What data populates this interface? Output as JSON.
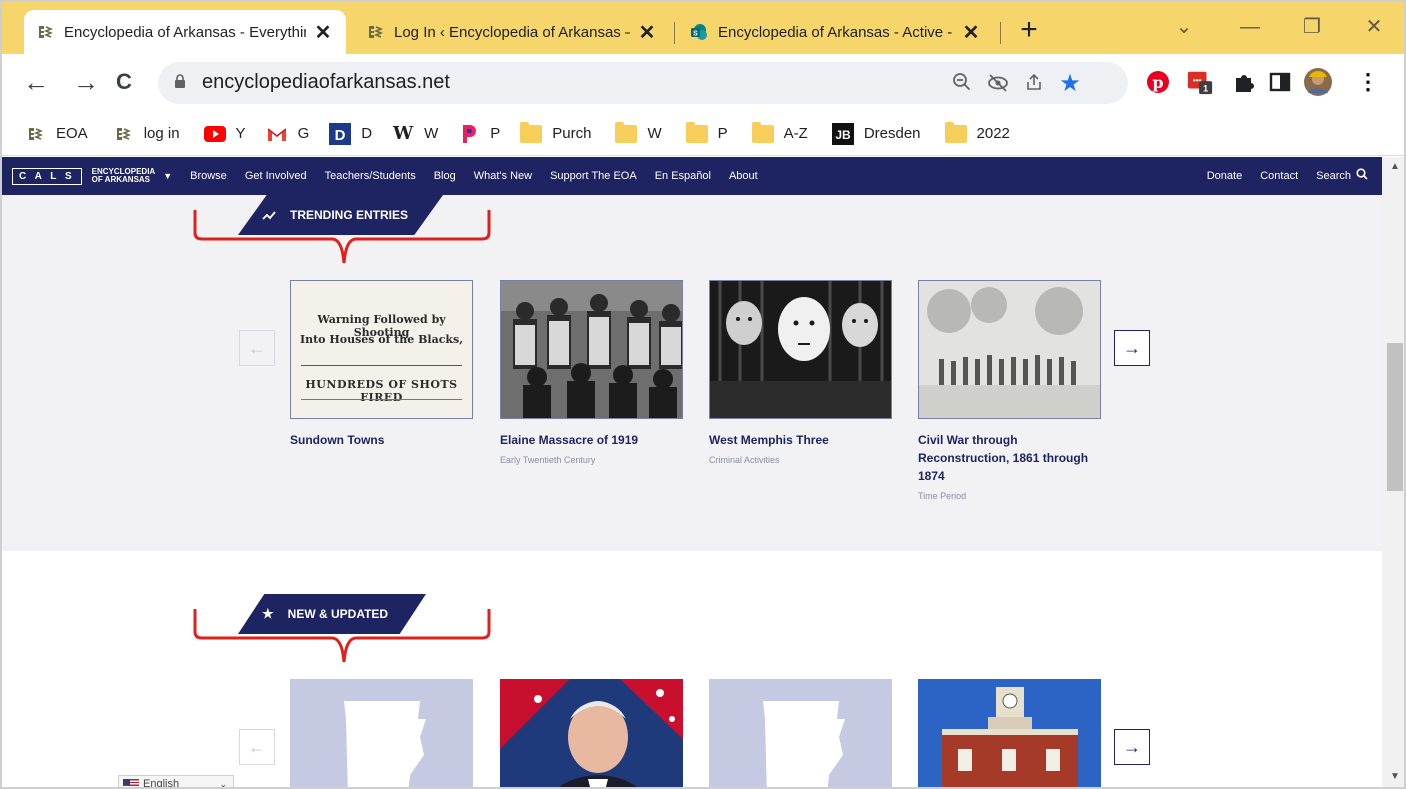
{
  "browser": {
    "tabs": [
      {
        "title": "Encyclopedia of Arkansas - Everything t",
        "active": true
      },
      {
        "title": "Log In ‹ Encyclopedia of Arkansas — W",
        "active": false
      },
      {
        "title": "Encyclopedia of Arkansas - Active - All I",
        "active": false
      }
    ],
    "new_tab_label": "+",
    "window_controls": {
      "dropdown": "⌄",
      "minimize": "—",
      "restore": "❐",
      "close": "✕"
    },
    "nav": {
      "back": "←",
      "forward": "→",
      "reload": "C"
    },
    "url": "encyclopediaofarkansas.net",
    "extension_badge": "1"
  },
  "bookmarks": [
    {
      "label": "EOA",
      "icon": "eoa-favicon-icon"
    },
    {
      "label": "log in",
      "icon": "eoa-favicon-icon"
    },
    {
      "label": "Y",
      "icon": "youtube-icon"
    },
    {
      "label": "G",
      "icon": "gmail-icon"
    },
    {
      "label": "D",
      "icon": "d-logo-icon"
    },
    {
      "label": "W",
      "icon": "wikipedia-icon"
    },
    {
      "label": "P",
      "icon": "p-logo-icon"
    },
    {
      "label": "Purch",
      "icon": "folder-icon"
    },
    {
      "label": "W",
      "icon": "folder-icon"
    },
    {
      "label": "P",
      "icon": "folder-icon"
    },
    {
      "label": "A-Z",
      "icon": "folder-icon"
    },
    {
      "label": "Dresden",
      "icon": "jb-logo-icon"
    },
    {
      "label": "2022",
      "icon": "folder-icon"
    }
  ],
  "site_nav": {
    "cals_logo": "C A L S",
    "eoa_logo_line1": "ENCYCLOPEDIA",
    "eoa_logo_line2": "OF ARKANSAS",
    "items": [
      "Browse",
      "Get Involved",
      "Teachers/Students",
      "Blog",
      "What's New",
      "Support The EOA",
      "En Español",
      "About"
    ],
    "right_items": [
      "Donate",
      "Contact",
      "Search"
    ]
  },
  "trending": {
    "banner": "TRENDING ENTRIES",
    "cards": [
      {
        "title": "Sundown Towns",
        "subtitle": ""
      },
      {
        "title": "Elaine Massacre of 1919",
        "subtitle": "Early Twentieth Century"
      },
      {
        "title": "West Memphis Three",
        "subtitle": "Criminal Activities"
      },
      {
        "title": "Civil War through Reconstruction, 1861 through 1874",
        "subtitle": "Time Period"
      }
    ],
    "newspaper": {
      "line1": "Warning Followed by Shooting",
      "line2": "Into Houses of the Blacks,",
      "line3": "HUNDREDS OF SHOTS FIRED"
    },
    "prev_arrow": "←",
    "next_arrow": "→"
  },
  "new_updated": {
    "banner": "NEW & UPDATED",
    "prev_arrow": "←",
    "next_arrow": "→"
  },
  "language": {
    "selected": "English"
  },
  "colors": {
    "tabstrip": "#f6d66a",
    "site_navy": "#1e2461",
    "section_bg": "#f2f2f4",
    "annotation_red": "#e0201c"
  }
}
